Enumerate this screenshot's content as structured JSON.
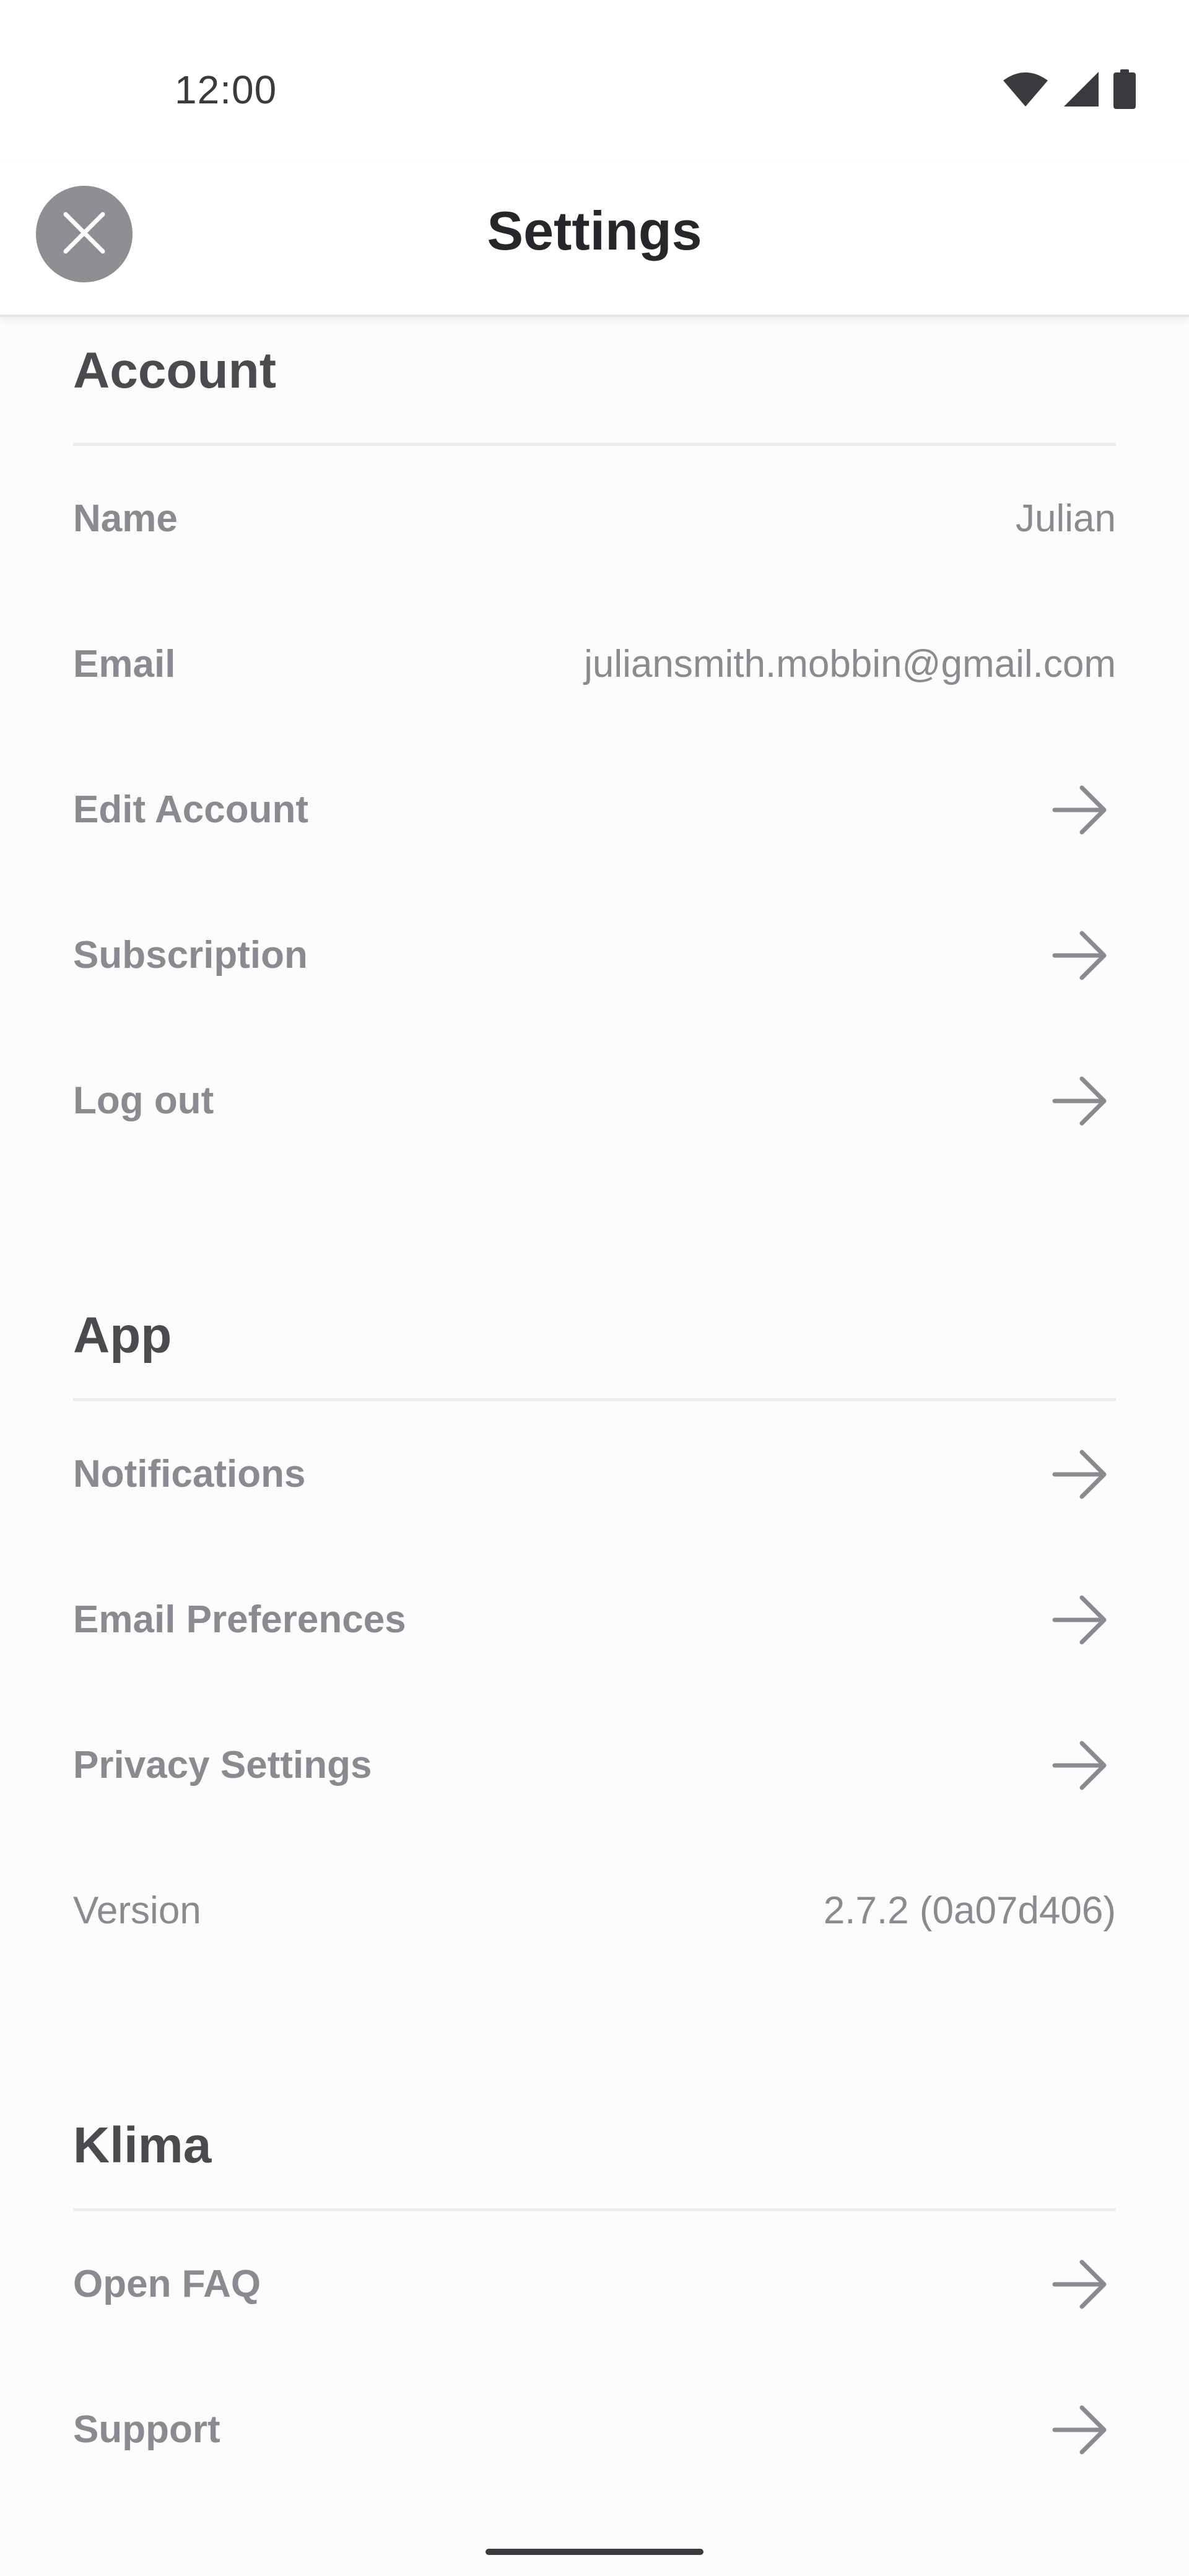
{
  "status_bar": {
    "time": "12:00",
    "icons": [
      "wifi-icon",
      "signal-icon",
      "battery-icon"
    ]
  },
  "header": {
    "title": "Settings",
    "close_icon": "close-icon"
  },
  "sections": {
    "account": {
      "title": "Account",
      "name_label": "Name",
      "name_value": "Julian",
      "email_label": "Email",
      "email_value": "juliansmith.mobbin@gmail.com",
      "edit_account_label": "Edit Account",
      "subscription_label": "Subscription",
      "logout_label": "Log out"
    },
    "app": {
      "title": "App",
      "notifications_label": "Notifications",
      "email_preferences_label": "Email Preferences",
      "privacy_settings_label": "Privacy Settings",
      "version_label": "Version",
      "version_value": "2.7.2 (0a07d406)"
    },
    "klima": {
      "title": "Klima",
      "open_faq_label": "Open FAQ",
      "support_label": "Support"
    }
  },
  "colors": {
    "close_button_bg": "#8e8e93",
    "title_text": "#26262b",
    "section_title": "#4a4a4f",
    "row_text": "#8a8a90",
    "divider": "#ececee"
  }
}
